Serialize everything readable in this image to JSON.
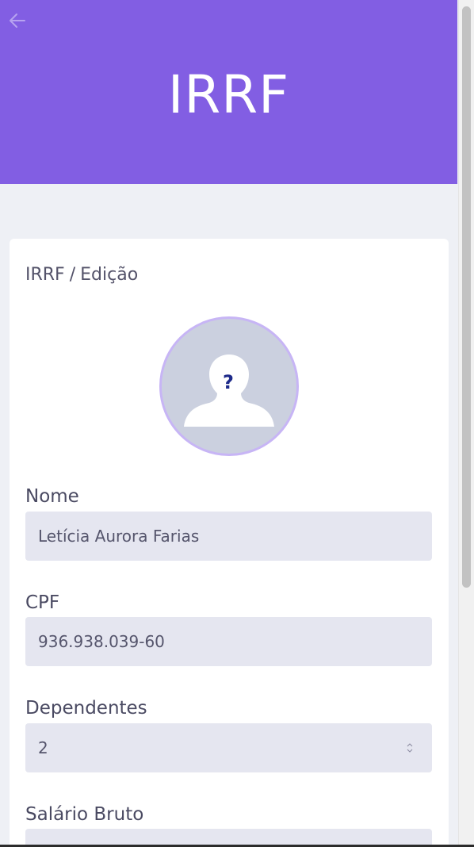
{
  "header": {
    "title": "IRRF",
    "back_icon": "arrow-left-icon",
    "background_color": "#825ee3"
  },
  "card": {
    "breadcrumb": {
      "section": "IRRF",
      "separator": "/",
      "page": "Edição"
    },
    "avatar": {
      "icon": "unknown-person-icon",
      "question_mark": "?"
    },
    "fields": [
      {
        "label": "Nome",
        "value": "Letícia Aurora Farias"
      },
      {
        "label": "CPF",
        "value": "936.938.039-60"
      },
      {
        "label": "Dependentes",
        "value": "2"
      },
      {
        "label": "Salário Bruto",
        "value": ""
      }
    ]
  }
}
